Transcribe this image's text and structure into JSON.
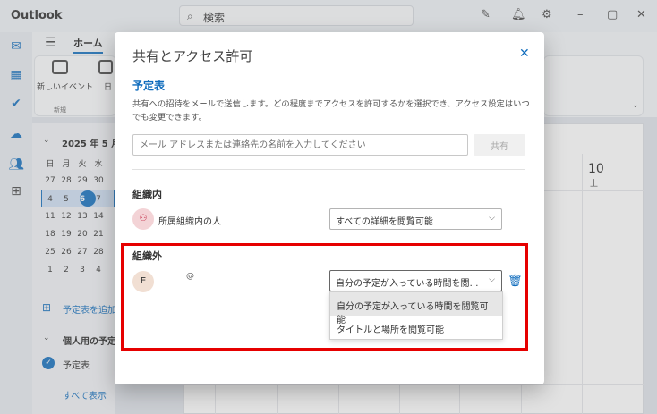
{
  "app": {
    "title": "Outlook",
    "search_label": "検索"
  },
  "ribbon": {
    "home_tab": "ホーム",
    "new_event": "新しいイベント",
    "new_group": "新規",
    "day": "日"
  },
  "navpane": {
    "month_title": "2025 年 5 月",
    "weekdays": [
      "日",
      "月",
      "火",
      "水"
    ],
    "weeks": [
      [
        "27",
        "28",
        "29",
        "30"
      ],
      [
        "4",
        "5",
        "6",
        "7"
      ],
      [
        "11",
        "12",
        "13",
        "14"
      ],
      [
        "18",
        "19",
        "20",
        "21"
      ],
      [
        "25",
        "26",
        "27",
        "28"
      ],
      [
        "1",
        "2",
        "3",
        "4"
      ]
    ],
    "add_calendar": "予定表を追加",
    "personal_group": "個人用の予定",
    "calendar_item": "予定表",
    "show_all": "すべて表示"
  },
  "grid": {
    "day_number": "10",
    "day_name": "土"
  },
  "dialog": {
    "title": "共有とアクセス許可",
    "section_title": "予定表",
    "description": "共有への招待をメールで送信します。どの程度までアクセスを許可するかを選択でき、アクセス設定はいつでも変更できます。",
    "email_placeholder": "メール アドレスまたは連絡先の名前を入力してください",
    "email_value": "",
    "share_button": "共有",
    "internal": {
      "label": "組織内",
      "person_name": "所属組織内の人",
      "permission": "すべての詳細を閲覧可能"
    },
    "external": {
      "label": "組織外",
      "avatar_initial": "E",
      "person_name": "",
      "permission_display": "自分の予定が入っている時間を閲覧可...",
      "options": [
        "自分の予定が入っている時間を閲覧可能",
        "タイトルと場所を閲覧可能"
      ],
      "selected_index": 0
    }
  },
  "colors": {
    "accent": "#0f6cbd",
    "highlight_box": "#e60000"
  }
}
